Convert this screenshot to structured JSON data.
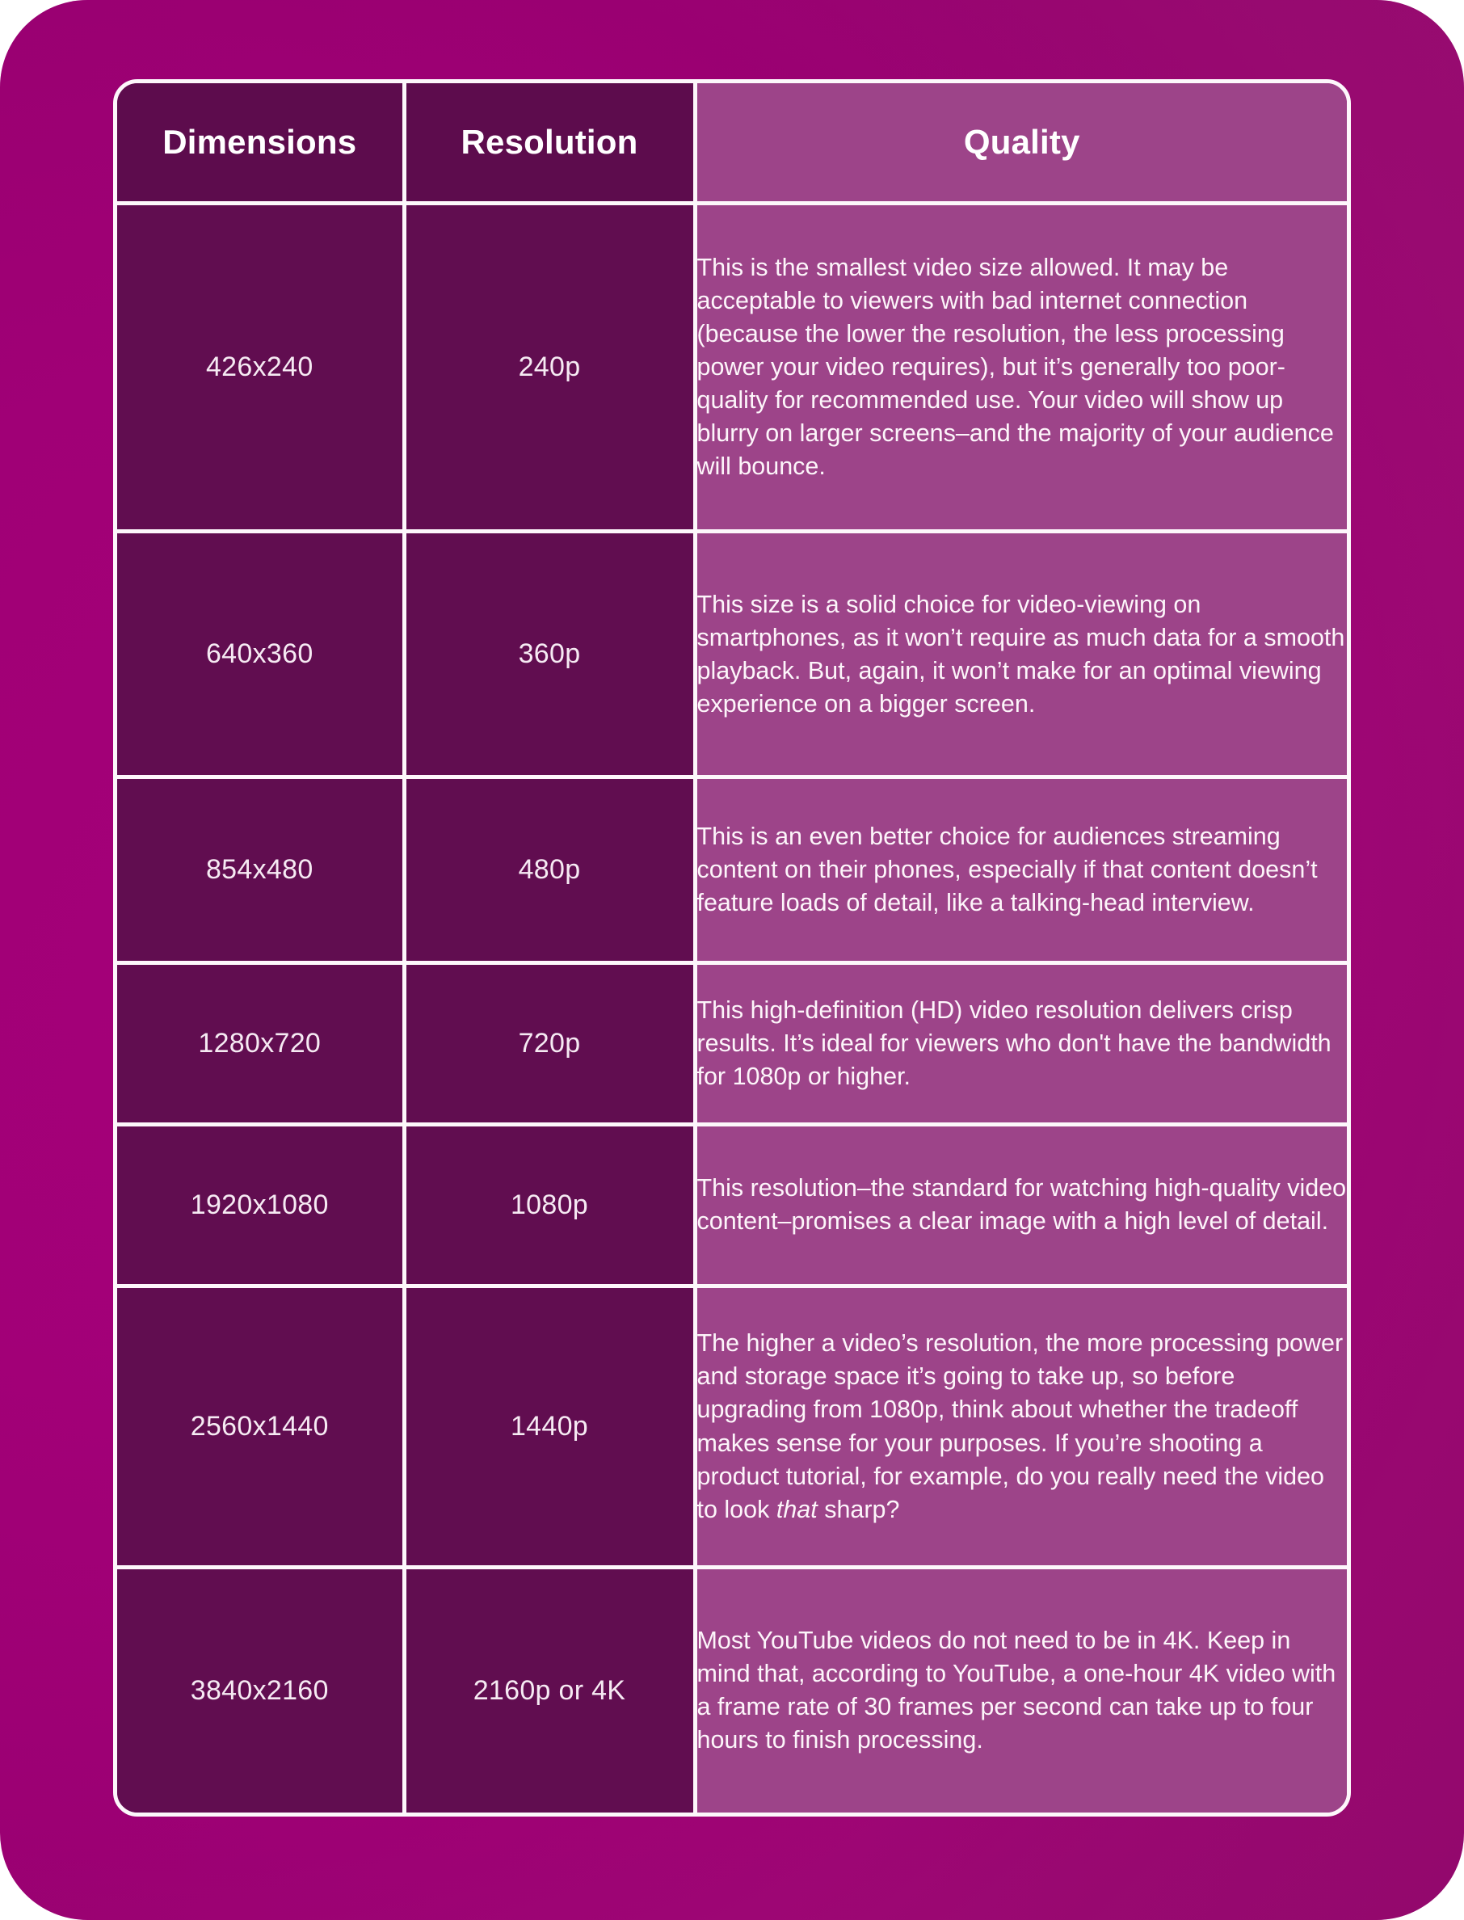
{
  "theme": {
    "background_start": "#a50079",
    "background_end": "#8e0c6a",
    "cell_dark": "#610d50",
    "cell_light": "#9d4489",
    "border": "#fdf7fb",
    "text": "#fdf5fa"
  },
  "table": {
    "headers": {
      "dimensions": "Dimensions",
      "resolution": "Resolution",
      "quality": "Quality"
    },
    "rows": [
      {
        "dimensions": "426x240",
        "resolution": "240p",
        "quality": "This is the smallest video size allowed. It may be acceptable to viewers with bad internet connection (because the lower the resolution, the less processing power your video requires), but it’s generally too poor-quality for recommended use. Your video will show up blurry on larger screens–and the majority of your audience will bounce."
      },
      {
        "dimensions": "640x360",
        "resolution": "360p",
        "quality": "This size is a solid choice for video-viewing on smartphones, as it won’t require as much data for a smooth playback. But, again, it won’t make for an optimal viewing experience on a bigger screen."
      },
      {
        "dimensions": "854x480",
        "resolution": "480p",
        "quality": "This is an even better choice for audiences streaming content on their phones, especially if that content doesn’t feature loads of detail, like a talking-head interview."
      },
      {
        "dimensions": "1280x720",
        "resolution": "720p",
        "quality": "This high-definition (HD) video resolution delivers crisp results. It’s ideal for viewers who don't have the bandwidth for 1080p or higher."
      },
      {
        "dimensions": "1920x1080",
        "resolution": "1080p",
        "quality": "This resolution–the standard for watching high-quality video content–promises a clear image with a high level of detail."
      },
      {
        "dimensions": "2560x1440",
        "resolution": "1440p",
        "quality_pre": "The higher a video’s resolution, the more processing power and storage space it’s going to take up, so before upgrading from 1080p, think about whether the tradeoff makes sense for your purposes. If you’re shooting a product tutorial, for example, do you really need the video to look ",
        "quality_em": "that",
        "quality_post": " sharp?"
      },
      {
        "dimensions": "3840x2160",
        "resolution": "2160p or 4K",
        "quality": "Most YouTube videos do not need to be in 4K. Keep in mind that, according to YouTube, a one-hour 4K video with a frame rate of 30 frames per second can take up to four hours to finish processing."
      }
    ]
  }
}
